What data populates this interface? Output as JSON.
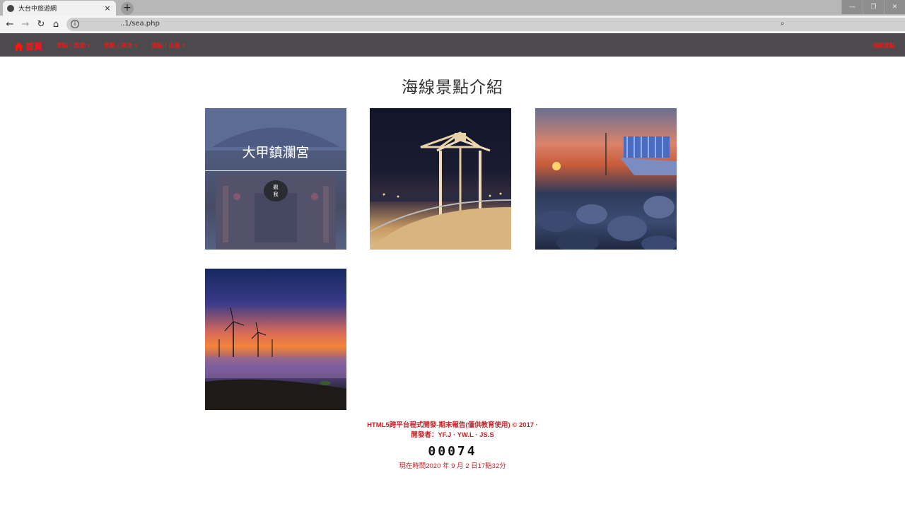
{
  "browser": {
    "tab_title": "大台中旅遊網",
    "tab_close": "×",
    "new_tab": "+",
    "url": "..1/sea.php",
    "window_buttons": [
      "—",
      "❐",
      "✕"
    ]
  },
  "nav": {
    "home": "首頁",
    "links": [
      "景點 / 旅遊 ▾",
      "景點 / 美食 ▾",
      "景點 / 山線 ▾"
    ],
    "right_link": "海線景點"
  },
  "main": {
    "title": "海線景點介紹",
    "cards": [
      {
        "caption": "大甲鎮瀾宮",
        "button": "觀\n我"
      },
      {
        "caption": ""
      },
      {
        "caption": ""
      },
      {
        "caption": ""
      }
    ]
  },
  "footer": {
    "line1": "HTML5跨平台程式開發-期末報告(僅供教育使用) © 2017 ·",
    "line2": "開發者：YF.J · YW.L · JS.S",
    "counter": "00074",
    "clock": "現在時間2020 年 9 月 2 日17點32分"
  },
  "colors": {
    "nav_bg": "#4c4a4d",
    "accent_red": "#ff1414",
    "footer_red": "#c0272d"
  }
}
